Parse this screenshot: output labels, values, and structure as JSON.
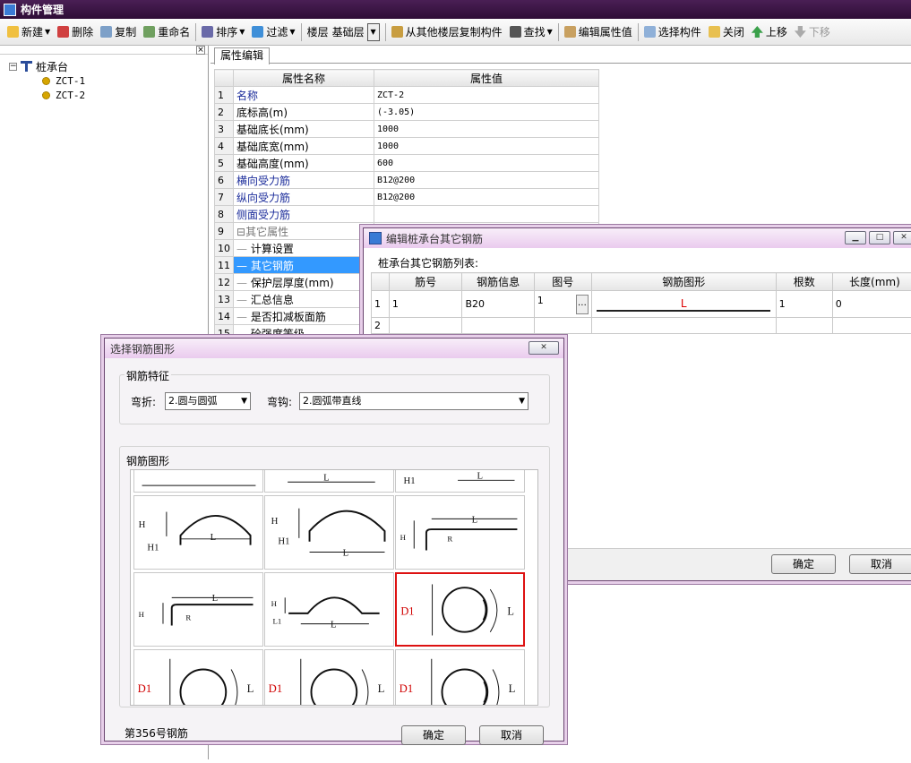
{
  "app": {
    "title": "构件管理"
  },
  "toolbar": {
    "new": "新建",
    "delete": "删除",
    "copy": "复制",
    "rename": "重命名",
    "sort": "排序",
    "filter": "过滤",
    "floor_label": "楼层",
    "floor_value": "基础层",
    "copy_from_floor": "从其他楼层复制构件",
    "find": "查找",
    "edit_props": "编辑属性值",
    "select_component": "选择构件",
    "close": "关闭",
    "move_up": "上移",
    "move_down": "下移"
  },
  "tree": {
    "root": "桩承台",
    "children": [
      "ZCT-1",
      "ZCT-2"
    ]
  },
  "tabs": {
    "props": "属性编辑"
  },
  "props": {
    "col_name": "属性名称",
    "col_value": "属性值",
    "rows": [
      {
        "n": "1",
        "name": "名称",
        "value": "ZCT-2"
      },
      {
        "n": "2",
        "name": "底标高(m)",
        "value": "(-3.05)"
      },
      {
        "n": "3",
        "name": "基础底长(mm)",
        "value": "1000"
      },
      {
        "n": "4",
        "name": "基础底宽(mm)",
        "value": "1000"
      },
      {
        "n": "5",
        "name": "基础高度(mm)",
        "value": "600"
      },
      {
        "n": "6",
        "name": "横向受力筋",
        "value": "B12@200"
      },
      {
        "n": "7",
        "name": "纵向受力筋",
        "value": "B12@200"
      },
      {
        "n": "8",
        "name": "侧面受力筋",
        "value": ""
      },
      {
        "n": "9",
        "name": "其它属性",
        "value": ""
      },
      {
        "n": "10",
        "name": "计算设置",
        "value": ""
      },
      {
        "n": "11",
        "name": "其它钢筋",
        "value": ""
      },
      {
        "n": "12",
        "name": "保护层厚度(mm)",
        "value": ""
      },
      {
        "n": "13",
        "name": "汇总信息",
        "value": ""
      },
      {
        "n": "14",
        "name": "是否扣减板面筋",
        "value": ""
      },
      {
        "n": "15",
        "name": "砼强度等级",
        "value": ""
      }
    ]
  },
  "rebar_dialog": {
    "title": "编辑桩承台其它钢筋",
    "list_label": "桩承台其它钢筋列表:",
    "headers": [
      "筋号",
      "钢筋信息",
      "图号",
      "钢筋图形",
      "根数",
      "长度(mm)"
    ],
    "rows": [
      {
        "n": "1",
        "no": "1",
        "info": "B20",
        "fig": "1",
        "shape_label": "L",
        "count": "1",
        "length": "0"
      },
      {
        "n": "2",
        "no": "",
        "info": "",
        "fig": "",
        "shape_label": "",
        "count": "",
        "length": ""
      }
    ],
    "ok": "确定",
    "cancel": "取消"
  },
  "shape_dialog": {
    "title": "选择钢筋图形",
    "features_label": "钢筋特征",
    "bend_label": "弯折:",
    "bend_value": "2.圆与圆弧",
    "hook_label": "弯钩:",
    "hook_value": "2.圆弧带直线",
    "shapes_label": "钢筋图形",
    "status": "第356号钢筋",
    "ok": "确定",
    "cancel": "取消",
    "labels": {
      "H": "H",
      "H1": "H1",
      "L": "L",
      "L1": "L1",
      "R": "R",
      "D1": "D1"
    }
  },
  "colors": {
    "title_bar": "#3a1245",
    "selection": "#3399ff",
    "selected_shape": "#d11111",
    "label_red": "#d00000"
  }
}
